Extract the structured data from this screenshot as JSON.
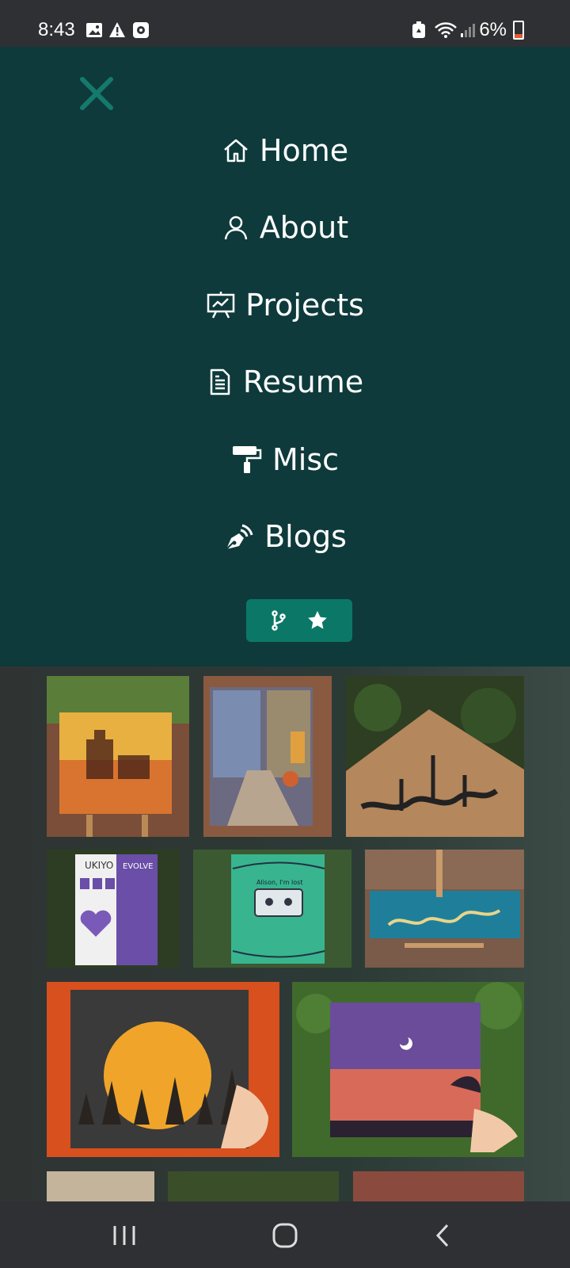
{
  "status_bar": {
    "time": "8:43",
    "battery": "6%",
    "icons": [
      "image-icon",
      "warning-icon",
      "app-notification-icon",
      "recycle-icon",
      "wifi-icon",
      "signal-icon",
      "battery-icon"
    ]
  },
  "menu": {
    "items": [
      {
        "label": "Home",
        "icon": "home-icon"
      },
      {
        "label": "About",
        "icon": "user-icon"
      },
      {
        "label": "Projects",
        "icon": "presentation-icon"
      },
      {
        "label": "Resume",
        "icon": "document-icon"
      },
      {
        "label": "Misc",
        "icon": "paint-roller-icon"
      },
      {
        "label": "Blogs",
        "icon": "pen-nib-icon"
      }
    ],
    "github_button_icons": [
      "git-fork-icon",
      "star-icon"
    ]
  },
  "gallery": {
    "images": [
      "painting-fort-sunset",
      "painting-street-alley",
      "calligraphy-wooden-board",
      "painting-ukiyo-evolve",
      "painting-cassette-tape",
      "calligraphy-blue-board",
      "painting-full-moon-forest",
      "painting-purple-sky-sunset"
    ],
    "easter_text": "Alison, I'm lost"
  },
  "colors": {
    "menu_bg": "#0e3a3b",
    "accent": "#0b7867",
    "close_icon": "#147a6c"
  }
}
